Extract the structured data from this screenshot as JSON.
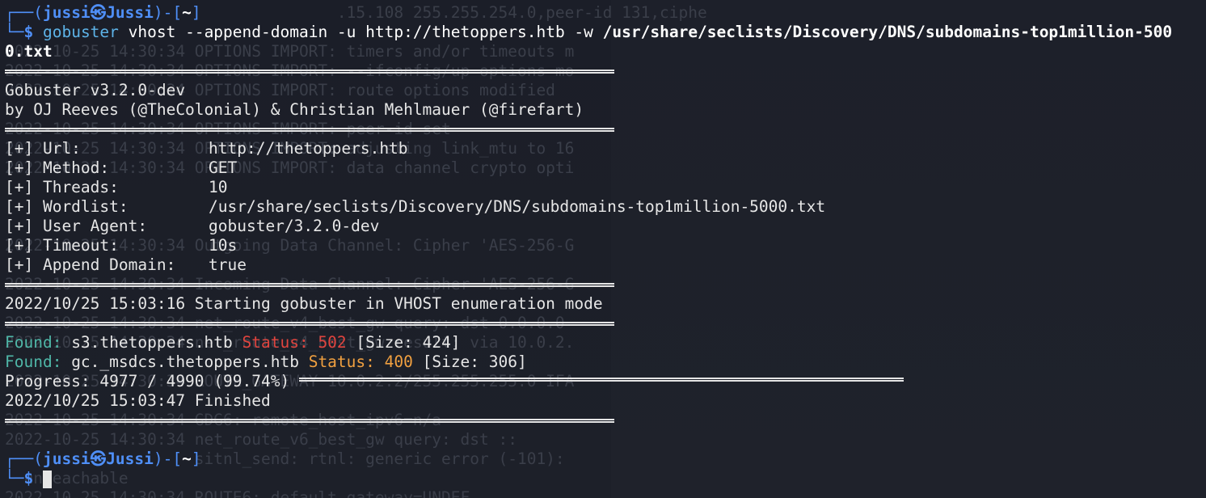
{
  "terminal": {
    "prompt": {
      "user": "jussi",
      "at": "㉿",
      "host": "Jussi",
      "dir": "~",
      "top_prefix": "┌──(",
      "top_mid": ")-[",
      "top_end": "]",
      "bottom_prefix": "└─",
      "dollar": "$"
    },
    "command": {
      "program": "gobuster",
      "args": " vhost --append-domain -u http://thetoppers.htb -w ",
      "wordlist_part1": "/usr/share/seclists/Discovery/DNS/subdomains-top1million-500",
      "wordlist_part2": "0.txt"
    },
    "banner": {
      "line1": "Gobuster v3.2.0-dev",
      "line2": "by OJ Reeves (@TheColonial) & Christian Mehlmauer (@firefart)"
    },
    "options": [
      {
        "key": "[+] Url:",
        "value": "http://thetoppers.htb"
      },
      {
        "key": "[+] Method:",
        "value": "GET"
      },
      {
        "key": "[+] Threads:",
        "value": "10"
      },
      {
        "key": "[+] Wordlist:",
        "value": "/usr/share/seclists/Discovery/DNS/subdomains-top1million-5000.txt"
      },
      {
        "key": "[+] User Agent:",
        "value": "gobuster/3.2.0-dev"
      },
      {
        "key": "[+] Timeout:",
        "value": "10s"
      },
      {
        "key": "[+] Append Domain:",
        "value": "true"
      }
    ],
    "start_line": "2022/10/25 15:03:16 Starting gobuster in VHOST enumeration mode",
    "results": [
      {
        "found": "Found:",
        "host": " s3.thetoppers.htb ",
        "status_label": "Status: ",
        "status": "502",
        "size": " [Size: 424]"
      },
      {
        "found": "Found:",
        "host": " gc._msdcs.thetoppers.htb ",
        "status_label": "Status: ",
        "status": "400",
        "size": " [Size: 306]"
      }
    ],
    "progress": "Progress: 4977 / 4990 (99.74%)",
    "finished": "2022/10/25 15:03:47 Finished",
    "ghost_lines": [
      "                                   .15.108 255.255.254.0,peer-id 131,ciphe",
      "2022-10-25 14:30:34 OPTIONS IMPORT: timers and/or timeouts m",
      "2022-10-25 14:30:34 OPTIONS IMPORT: --ifconfig/up options mo",
      "2022-10-25 14:30:34 OPTIONS IMPORT: route options modified",
      "2022-10-25 14:30:34 OPTIONS IMPORT: peer-id set",
      "2022-10-25 14:30:34 OPTIONS IMPORT: adjusting link_mtu to 16",
      "2022-10-25 14:30:34 OPTIONS IMPORT: data channel crypto opti",
      "2022-10-25 14:30:34 Outgoing Data Channel: Cipher 'AES-256-G",
      "2022-10-25 14:30:34 Incoming Data Channel: Cipher 'AES-256-G",
      "2022-10-25 14:30:34 net_route_v4_best_gw query: dst 0.0.0.0",
      "2022-10-25 14:30:34 net_route_v4_best_gw result: via 10.0.2.",
      "2022-10-25 14:30:34 ROUTE_GATEWAY 10.0.2.2/255.255.255.0 IFA",
      "2022-10-25 14:30:34 GDG6: remote_host_ipv6=n/a",
      "2022-10-25 14:30:34 net_route_v6_best_gw query: dst ::",
      "                    sitnl_send: rtnl: generic error (-101):",
      "  unreachable",
      "2022-10-25 14:30:34 ROUTE6: default_gateway=UNDEF"
    ]
  }
}
